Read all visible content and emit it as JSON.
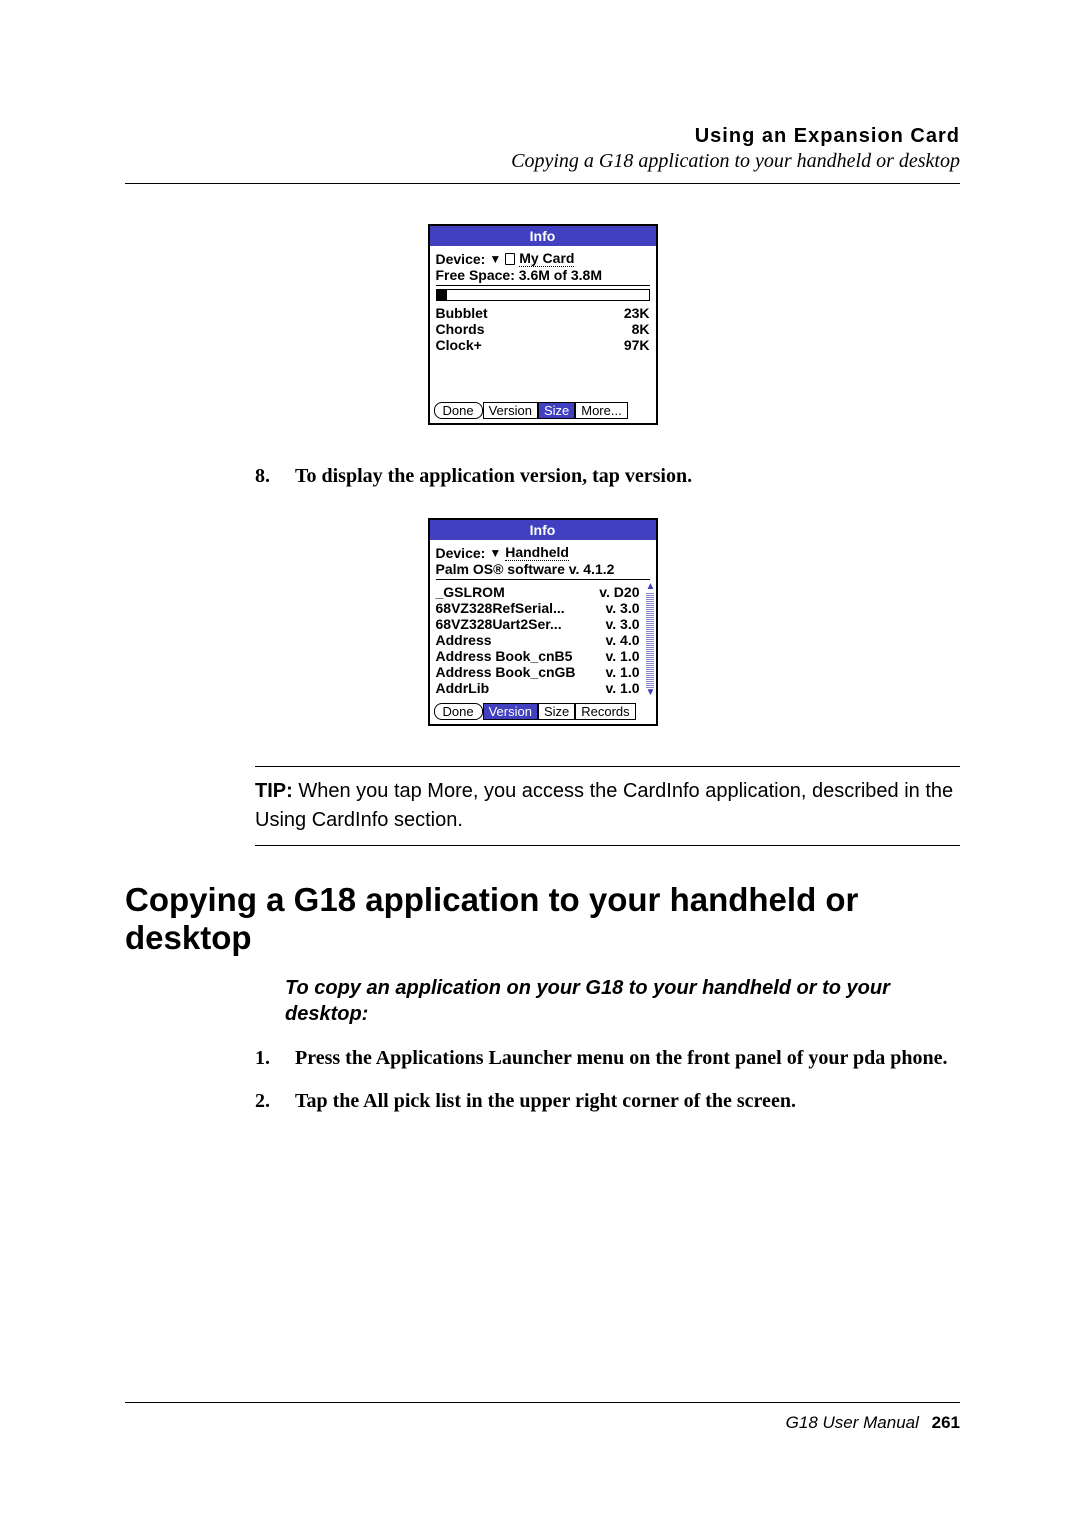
{
  "header": {
    "title": "Using an Expansion Card",
    "subtitle": "Copying a G18 application to your handheld or desktop"
  },
  "screenshot1": {
    "title": "Info",
    "device_label": "Device:",
    "device_value": "My Card",
    "free_space": "Free Space: 3.6M of 3.8M",
    "rows": [
      {
        "name": "Bubblet",
        "size": "23K"
      },
      {
        "name": "Chords",
        "size": "8K"
      },
      {
        "name": "Clock+",
        "size": "97K"
      }
    ],
    "buttons": {
      "done": "Done",
      "version": "Version",
      "size": "Size",
      "more": "More..."
    }
  },
  "step8": {
    "num": "8.",
    "text": "To display the application version, tap version."
  },
  "screenshot2": {
    "title": "Info",
    "device_label": "Device:",
    "device_value": "Handheld",
    "os_line": "Palm OS® software v. 4.1.2",
    "rows": [
      {
        "name": "_GSLROM",
        "ver": "v. D20"
      },
      {
        "name": "68VZ328RefSerial...",
        "ver": "v. 3.0"
      },
      {
        "name": "68VZ328Uart2Ser...",
        "ver": "v. 3.0"
      },
      {
        "name": "Address",
        "ver": "v. 4.0"
      },
      {
        "name": "Address Book_cnB5",
        "ver": "v. 1.0"
      },
      {
        "name": "Address Book_cnGB",
        "ver": "v. 1.0"
      },
      {
        "name": "AddrLib",
        "ver": "v. 1.0"
      }
    ],
    "buttons": {
      "done": "Done",
      "version": "Version",
      "size": "Size",
      "records": "Records"
    }
  },
  "tip": {
    "label": "TIP:",
    "body": "When you tap More, you access the CardInfo application, described in the Using CardInfo section."
  },
  "heading": "Copying a G18 application to your handheld or desktop",
  "instruction": "To copy an application on your  G18 to your handheld or to your desktop:",
  "steps": [
    {
      "num": "1.",
      "text": "Press the Applications Launcher menu on the front panel of your pda phone."
    },
    {
      "num": "2.",
      "text": "Tap the All pick list in the upper right corner of the screen."
    }
  ],
  "footer": {
    "manual": "G18 User Manual",
    "page": "261"
  }
}
